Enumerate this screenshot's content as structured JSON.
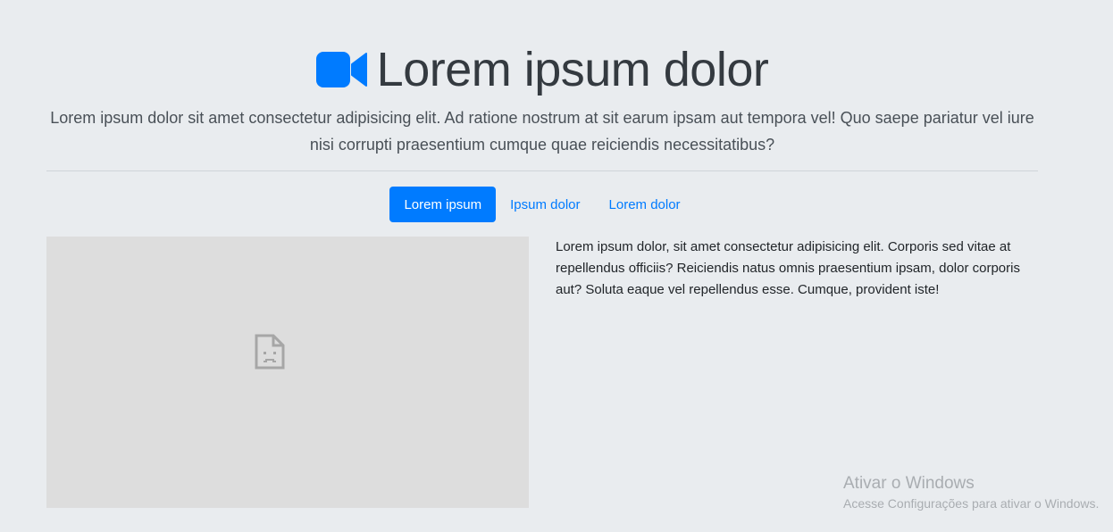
{
  "header": {
    "icon": "video-camera-icon",
    "title": "Lorem ipsum dolor",
    "lead": "Lorem ipsum dolor sit amet consectetur adipisicing elit. Ad ratione nostrum at sit earum ipsam aut tempora vel! Quo saepe pariatur vel iure nisi corrupti praesentium cumque quae reiciendis necessitatibus?"
  },
  "tabs": [
    {
      "label": "Lorem ipsum",
      "active": true
    },
    {
      "label": "Ipsum dolor",
      "active": false
    },
    {
      "label": "Lorem dolor",
      "active": false
    }
  ],
  "content": {
    "media_icon": "broken-page-icon",
    "text": "Lorem ipsum dolor, sit amet consectetur adipisicing elit. Corporis sed vitae at repellendus officiis? Reiciendis natus omnis praesentium ipsam, dolor corporis aut? Soluta eaque vel repellendus esse. Cumque, provident iste!"
  },
  "watermark": {
    "title": "Ativar o Windows",
    "subtitle": "Acesse Configurações para ativar o Windows."
  },
  "colors": {
    "background": "#e9ecef",
    "accent": "#007bff",
    "media_placeholder": "#dddddd"
  }
}
